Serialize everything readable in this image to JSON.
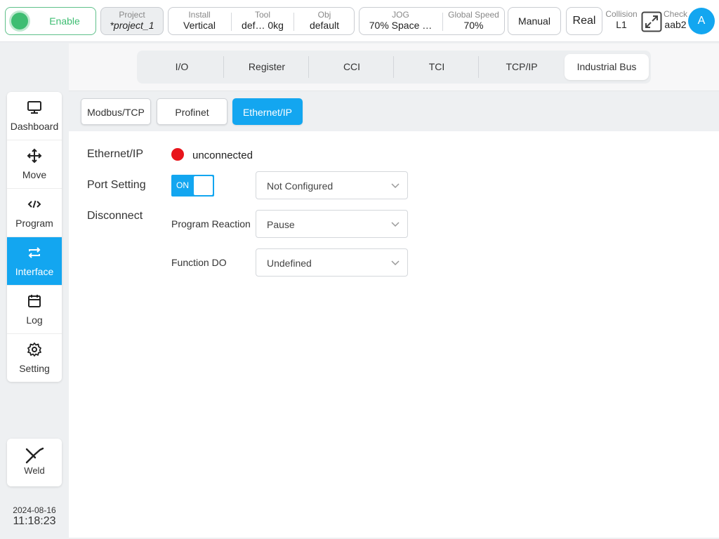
{
  "topbar": {
    "enable_label": "Enable",
    "project": {
      "label": "Project",
      "value": "*project_1"
    },
    "install": {
      "label": "Install",
      "value": "Vertical"
    },
    "tool": {
      "label": "Tool",
      "value": "def…   0kg"
    },
    "obj": {
      "label": "Obj",
      "value": "default"
    },
    "jog": {
      "label": "JOG",
      "value": "70%   Space …"
    },
    "global_speed": {
      "label": "Global Speed",
      "value": "70%"
    },
    "mode": "Manual",
    "real": "Real",
    "collision": {
      "label": "Collision",
      "value": "L1"
    },
    "check": {
      "label": "Check",
      "value": "aab2"
    },
    "avatar": "A",
    "accent_color": "#13a6f0",
    "enable_color": "#3ebd72"
  },
  "sidebar": {
    "items": [
      {
        "label": "Dashboard",
        "icon": "monitor-icon"
      },
      {
        "label": "Move",
        "icon": "move-arrows-icon"
      },
      {
        "label": "Program",
        "icon": "code-icon"
      },
      {
        "label": "Interface",
        "icon": "swap-arrows-icon",
        "active": true
      },
      {
        "label": "Log",
        "icon": "calendar-icon"
      },
      {
        "label": "Setting",
        "icon": "gear-icon"
      }
    ],
    "weld_label": "Weld",
    "date": "2024-08-16",
    "time": "11:18:23"
  },
  "main_tabs": [
    "I/O",
    "Register",
    "CCI",
    "TCI",
    "TCP/IP",
    "Industrial Bus"
  ],
  "active_main_tab": "Industrial Bus",
  "sub_tabs": [
    "Modbus/TCP",
    "Profinet",
    "Ethernet/IP"
  ],
  "active_sub_tab": "Ethernet/IP",
  "form": {
    "ethernet_ip_label": "Ethernet/IP",
    "status_text": "unconnected",
    "status_color": "#e8141b",
    "port_setting_label": "Port Setting",
    "toggle_label": "ON",
    "port_value": "Not Configured",
    "disconnect_label": "Disconnect",
    "program_reaction_label": "Program Reaction",
    "program_reaction_value": "Pause",
    "function_do_label": "Function DO",
    "function_do_value": "Undefined"
  }
}
